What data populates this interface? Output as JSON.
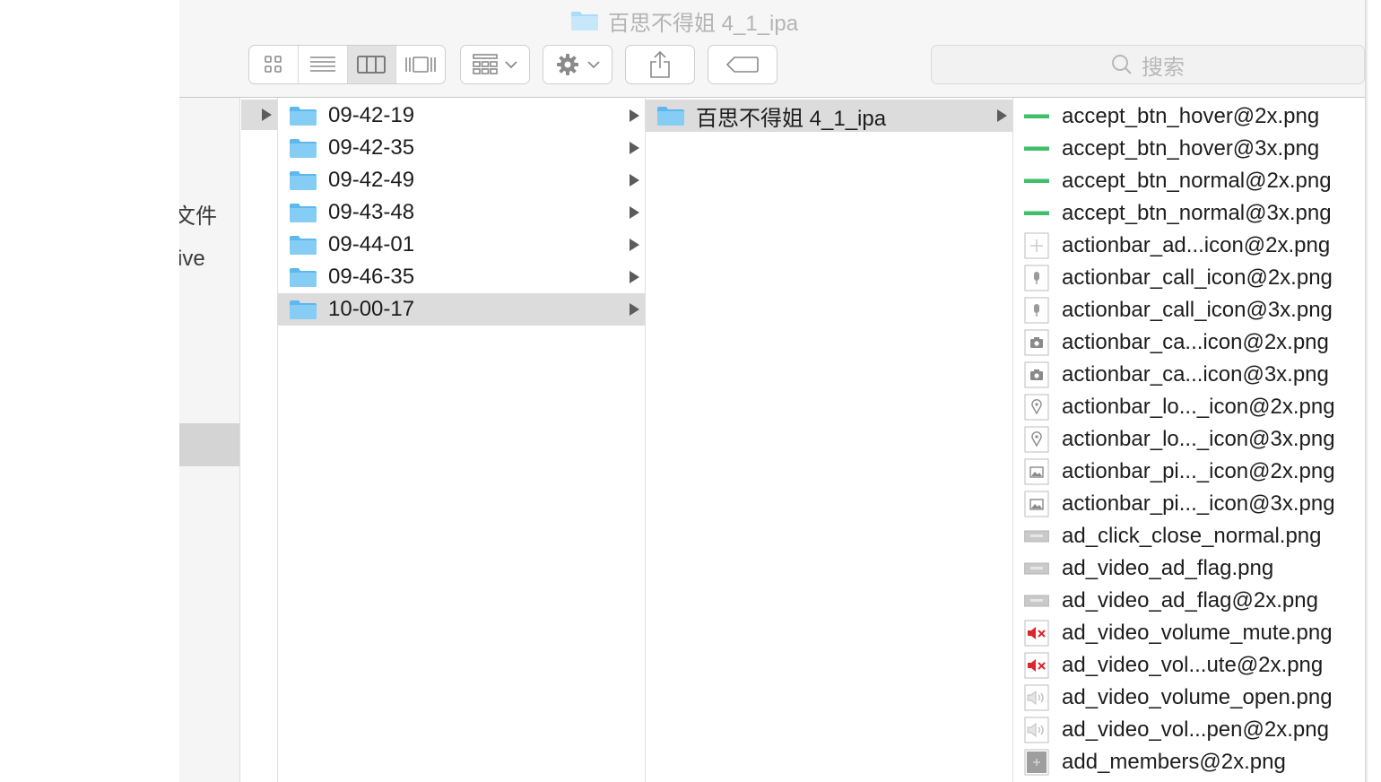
{
  "window": {
    "title": "百思不得姐 4_1_ipa",
    "search_placeholder": "搜索"
  },
  "toolbar": {
    "view_buttons": [
      "icon-view-icon",
      "list-view-icon",
      "column-view-icon",
      "coverflow-view-icon"
    ],
    "active_view": "column"
  },
  "sidebar": {
    "items": [
      {
        "label": "文件"
      },
      {
        "label": "ive"
      }
    ]
  },
  "column1": {
    "rows": [
      {
        "label": "",
        "selected": true
      }
    ]
  },
  "column2": {
    "rows": [
      {
        "label": "09-42-19",
        "selected": false
      },
      {
        "label": "09-42-35",
        "selected": false
      },
      {
        "label": "09-42-49",
        "selected": false
      },
      {
        "label": "09-43-48",
        "selected": false
      },
      {
        "label": "09-44-01",
        "selected": false
      },
      {
        "label": "09-46-35",
        "selected": false
      },
      {
        "label": "10-00-17",
        "selected": true
      }
    ]
  },
  "column3": {
    "rows": [
      {
        "label": "百思不得姐 4_1_ipa",
        "selected": true
      }
    ]
  },
  "column4": {
    "files": [
      {
        "name": "accept_btn_hover@2x.png",
        "icon": "green-line"
      },
      {
        "name": "accept_btn_hover@3x.png",
        "icon": "green-line"
      },
      {
        "name": "accept_btn_normal@2x.png",
        "icon": "green-line"
      },
      {
        "name": "accept_btn_normal@3x.png",
        "icon": "green-line"
      },
      {
        "name": "actionbar_ad...icon@2x.png",
        "icon": "plus"
      },
      {
        "name": "actionbar_call_icon@2x.png",
        "icon": "mic"
      },
      {
        "name": "actionbar_call_icon@3x.png",
        "icon": "mic"
      },
      {
        "name": "actionbar_ca...icon@2x.png",
        "icon": "camera"
      },
      {
        "name": "actionbar_ca...icon@3x.png",
        "icon": "camera"
      },
      {
        "name": "actionbar_lo..._icon@2x.png",
        "icon": "pin"
      },
      {
        "name": "actionbar_lo..._icon@3x.png",
        "icon": "pin"
      },
      {
        "name": "actionbar_pi..._icon@2x.png",
        "icon": "picture"
      },
      {
        "name": "actionbar_pi..._icon@3x.png",
        "icon": "picture"
      },
      {
        "name": "ad_click_close_normal.png",
        "icon": "gray-bar"
      },
      {
        "name": "ad_video_ad_flag.png",
        "icon": "gray-bar"
      },
      {
        "name": "ad_video_ad_flag@2x.png",
        "icon": "gray-bar"
      },
      {
        "name": "ad_video_volume_mute.png",
        "icon": "mute"
      },
      {
        "name": "ad_video_vol...ute@2x.png",
        "icon": "mute"
      },
      {
        "name": "ad_video_volume_open.png",
        "icon": "speaker"
      },
      {
        "name": "ad_video_vol...pen@2x.png",
        "icon": "speaker"
      },
      {
        "name": "add_members@2x.png",
        "icon": "gray-square"
      }
    ]
  },
  "colors": {
    "folder": "#7ccbf5",
    "selection": "#dcdcdc",
    "accent_green": "#3fbf6a",
    "mute_red": "#e0242c"
  }
}
